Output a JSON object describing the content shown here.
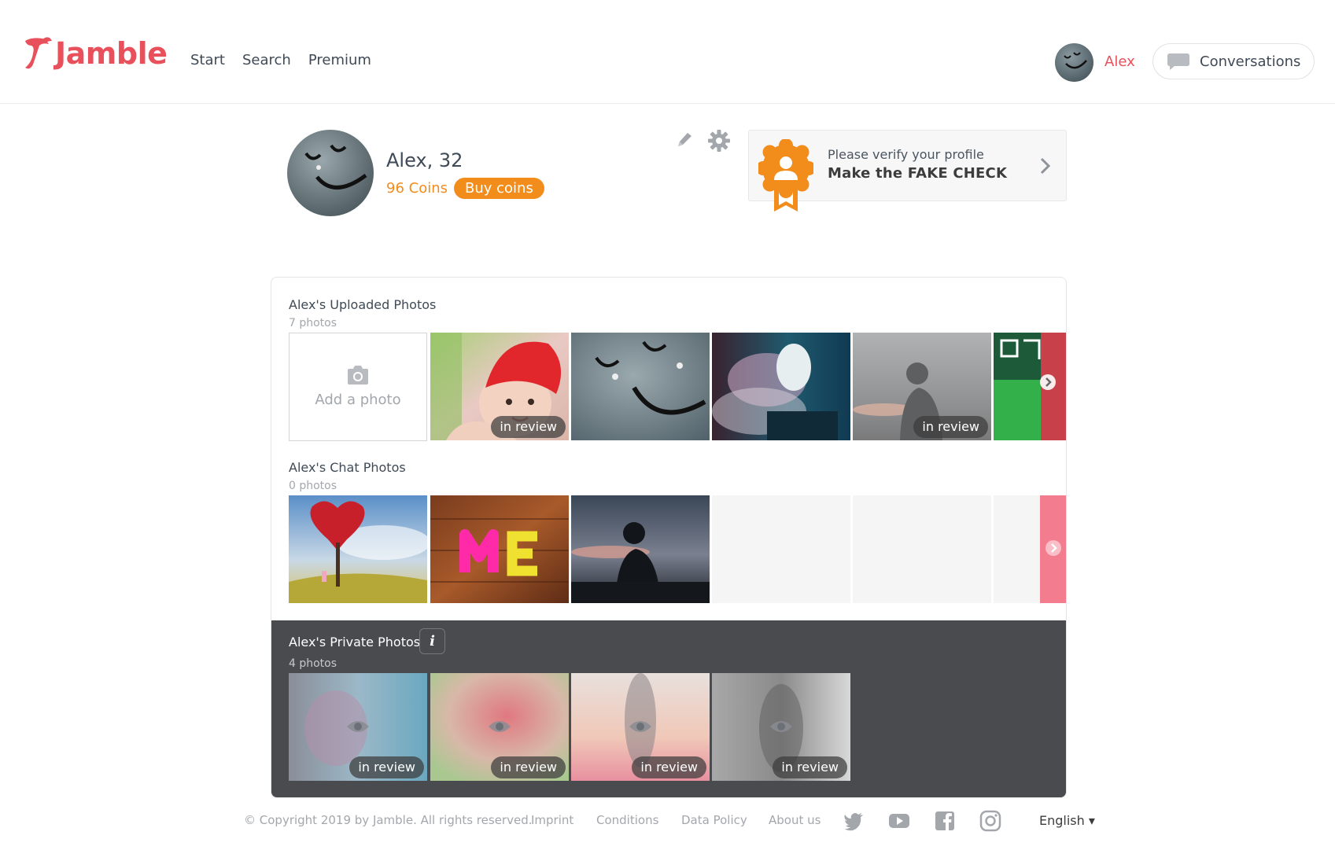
{
  "brand": {
    "name": "Jamble",
    "color": "#e8505b"
  },
  "nav": {
    "items": [
      "Start",
      "Search",
      "Premium"
    ]
  },
  "header": {
    "user_name": "Alex",
    "conversations_label": "Conversations"
  },
  "profile": {
    "name_age": "Alex, 32",
    "coins": "96 Coins",
    "buy_coins_label": "Buy coins",
    "accent": "#f28c1b"
  },
  "verify": {
    "line1": "Please verify your profile",
    "line2": "Make the FAKE CHECK"
  },
  "uploaded": {
    "title": "Alex's Uploaded Photos",
    "count": "7 photos",
    "add_label": "Add a photo",
    "review_label": "in review",
    "photos": [
      {
        "subject": "baby in red hat",
        "in_review": true
      },
      {
        "subject": "smiley face on stone",
        "in_review": false
      },
      {
        "subject": "masked person in smoke",
        "in_review": false
      },
      {
        "subject": "silhouette against sky",
        "in_review": true
      },
      {
        "subject": "book covers",
        "in_review": false
      }
    ]
  },
  "chat": {
    "title": "Alex's Chat Photos",
    "count": "0 photos",
    "photos": [
      {
        "subject": "red heart tree"
      },
      {
        "subject": "ME letters on wood"
      },
      {
        "subject": "silhouette at dusk"
      }
    ]
  },
  "private": {
    "title": "Alex's Private Photos",
    "info_icon": "i",
    "count": "4 photos",
    "review_label": "in review",
    "photos": [
      {
        "in_review": true
      },
      {
        "in_review": true
      },
      {
        "in_review": true
      },
      {
        "in_review": true
      }
    ]
  },
  "footer": {
    "copyright": "© Copyright 2019 by Jamble. All rights reserved.",
    "links": [
      "Imprint",
      "Conditions",
      "Data Policy",
      "About us"
    ],
    "social": [
      "twitter-icon",
      "youtube-icon",
      "facebook-icon",
      "instagram-icon"
    ],
    "language": "English ▾"
  }
}
